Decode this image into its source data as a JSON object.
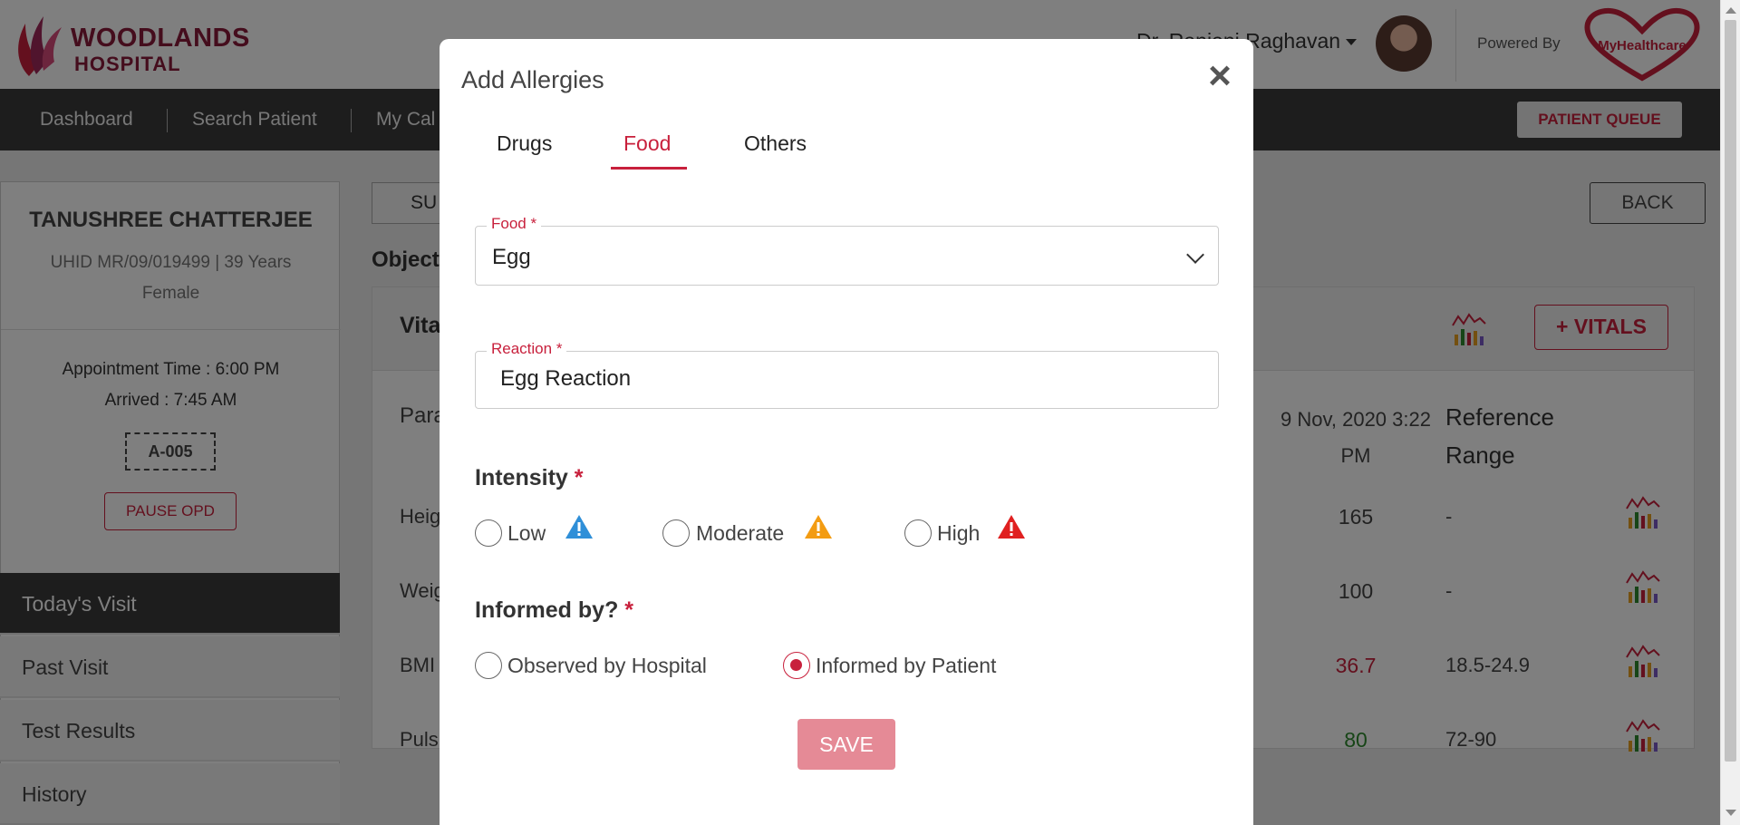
{
  "header": {
    "logo_line1": "WOODLANDS",
    "logo_line2": "HOSPITAL",
    "doctor_name": "Dr. Ranjani Raghavan",
    "powered_by": "Powered By",
    "brand_name": "MyHealthcare"
  },
  "nav": {
    "items": [
      "Dashboard",
      "Search Patient",
      "My Cal"
    ],
    "patient_queue": "PATIENT QUEUE"
  },
  "patient": {
    "name": "TANUSHREE CHATTERJEE",
    "info": "UHID MR/09/019499 | 39 Years Female",
    "appointment_time": "Appointment Time : 6:00 PM",
    "arrived": "Arrived : 7:45 AM",
    "token": "A-005",
    "pause_label": "PAUSE OPD"
  },
  "sidebar": {
    "items": [
      {
        "label": "Today's Visit",
        "active": true
      },
      {
        "label": "Past Visit"
      },
      {
        "label": "Test Results"
      },
      {
        "label": "History"
      }
    ]
  },
  "main": {
    "tab_label": "SU",
    "section_label": "Object",
    "back_label": "BACK",
    "vitals_title": "Vita",
    "add_vitals_label": "+ VITALS",
    "param_header": "Para",
    "date_header": "9 Nov, 2020 3:22 PM",
    "ref_header": "Reference Range",
    "rows": [
      {
        "label": "Heig",
        "value": "165",
        "ref": "-",
        "color": "#444444"
      },
      {
        "label": "Weig",
        "value": "100",
        "ref": "-",
        "color": "#444444"
      },
      {
        "label": "BMI",
        "value": "36.7",
        "ref": "18.5-24.9",
        "color": "#c8203c"
      },
      {
        "label": "Puls",
        "value": "80",
        "ref": "72-90",
        "color": "#2e8b2e"
      }
    ]
  },
  "modal": {
    "title": "Add Allergies",
    "tabs": [
      {
        "label": "Drugs"
      },
      {
        "label": "Food",
        "active": true
      },
      {
        "label": "Others"
      }
    ],
    "food_label": "Food *",
    "food_value": "Egg",
    "reaction_label": "Reaction *",
    "reaction_value": "Egg Reaction",
    "intensity_title": "Intensity",
    "intensity_options": [
      {
        "label": "Low",
        "icon": "warning-blue-icon",
        "color": "#2f8fd8"
      },
      {
        "label": "Moderate",
        "icon": "warning-orange-icon",
        "color": "#f39c12"
      },
      {
        "label": "High",
        "icon": "warning-red-icon",
        "color": "#e02020"
      }
    ],
    "informed_title": "Informed by?",
    "informed_options": [
      {
        "label": "Observed by Hospital",
        "checked": false
      },
      {
        "label": "Informed by Patient",
        "checked": true
      }
    ],
    "required_mark": "*",
    "save_label": "SAVE"
  },
  "colors": {
    "accent": "#c8203c",
    "nav_bg": "#3b3b3b",
    "save_disabled": "#e58a96"
  }
}
